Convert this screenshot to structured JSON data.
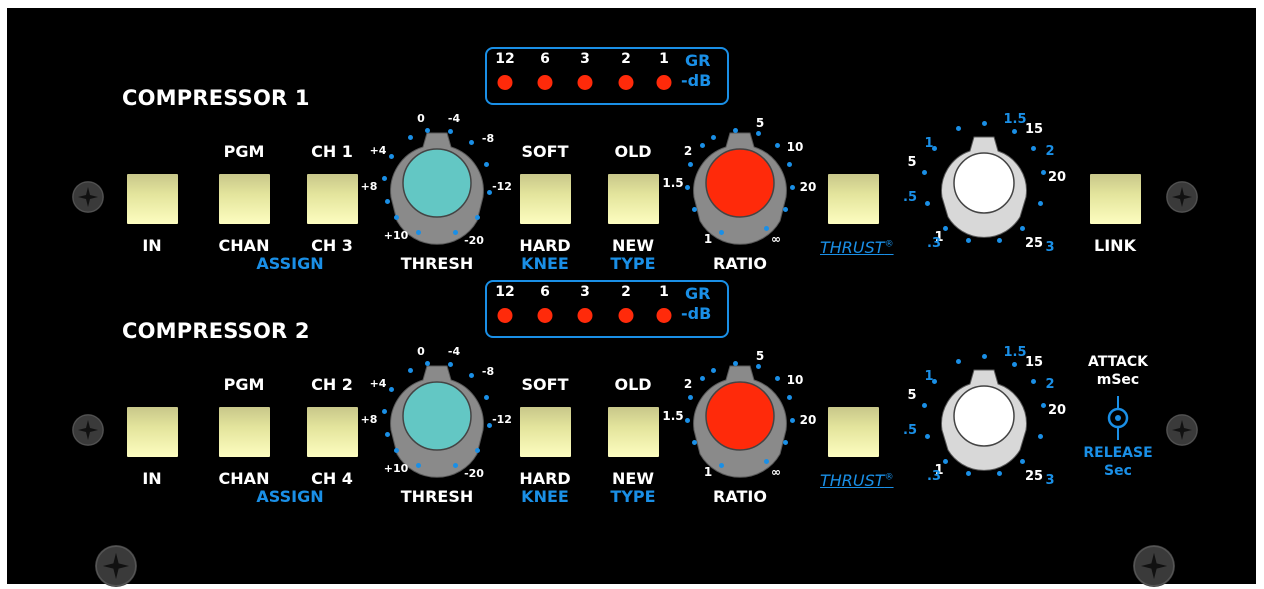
{
  "colors": {
    "panel": "#000000",
    "accent_blue": "#1a8fe6",
    "threshold_knob": "#63c7c4",
    "ratio_knob": "#ff2a0a",
    "button_yellow": "#fdfdc0",
    "led_red": "#ff2a0a"
  },
  "compressors": [
    {
      "title": "COMPRESSOR 1",
      "gr_meter": {
        "steps": [
          "12",
          "6",
          "3",
          "2",
          "1"
        ],
        "unit_top": "GR",
        "unit_bottom": "-dB"
      },
      "in_button": {
        "label": "IN"
      },
      "assign": {
        "chan_top": "PGM",
        "chan_bottom": "CHAN",
        "ch_top": "CH 1",
        "ch_bottom": "CH 3",
        "group_label": "ASSIGN"
      },
      "thresh": {
        "label": "THRESH",
        "marks": [
          "0",
          "-4",
          "-8",
          "-12",
          "-20",
          "+10",
          "+8",
          "+4"
        ],
        "knob_color": "threshold"
      },
      "knee": {
        "top": "SOFT",
        "bottom": "HARD",
        "group_label": "KNEE"
      },
      "type": {
        "top": "OLD",
        "bottom": "NEW",
        "group_label": "TYPE"
      },
      "ratio": {
        "label": "RATIO",
        "marks": [
          "2",
          "5",
          "10",
          "20",
          "∞",
          "1",
          "1.5"
        ]
      },
      "thrust": {
        "label": "THRUST",
        "reg": "®"
      },
      "attack_release": {
        "white_marks": [
          "5",
          "1",
          "15",
          "20",
          "25"
        ],
        "blue_marks": [
          ".5",
          "1",
          ".3",
          "1.5",
          "2",
          "3"
        ]
      },
      "link": {
        "label": "LINK"
      }
    },
    {
      "title": "COMPRESSOR 2",
      "gr_meter": {
        "steps": [
          "12",
          "6",
          "3",
          "2",
          "1"
        ],
        "unit_top": "GR",
        "unit_bottom": "-dB"
      },
      "in_button": {
        "label": "IN"
      },
      "assign": {
        "chan_top": "PGM",
        "chan_bottom": "CHAN",
        "ch_top": "CH 2",
        "ch_bottom": "CH 4",
        "group_label": "ASSIGN"
      },
      "thresh": {
        "label": "THRESH",
        "marks": [
          "0",
          "-4",
          "-8",
          "-12",
          "-20",
          "+10",
          "+8",
          "+4"
        ],
        "knob_color": "threshold"
      },
      "knee": {
        "top": "SOFT",
        "bottom": "HARD",
        "group_label": "KNEE"
      },
      "type": {
        "top": "OLD",
        "bottom": "NEW",
        "group_label": "TYPE"
      },
      "ratio": {
        "label": "RATIO",
        "marks": [
          "2",
          "5",
          "10",
          "20",
          "∞",
          "1",
          "1.5"
        ]
      },
      "thrust": {
        "label": "THRUST",
        "reg": "®"
      },
      "attack_release": {
        "white_marks": [
          "5",
          "1",
          "15",
          "20",
          "25"
        ],
        "blue_marks": [
          ".5",
          "1",
          ".3",
          "1.5",
          "2",
          "3"
        ]
      },
      "jack": {
        "top1": "ATTACK",
        "top2": "mSec",
        "bottom1": "RELEASE",
        "bottom2": "Sec"
      }
    }
  ]
}
